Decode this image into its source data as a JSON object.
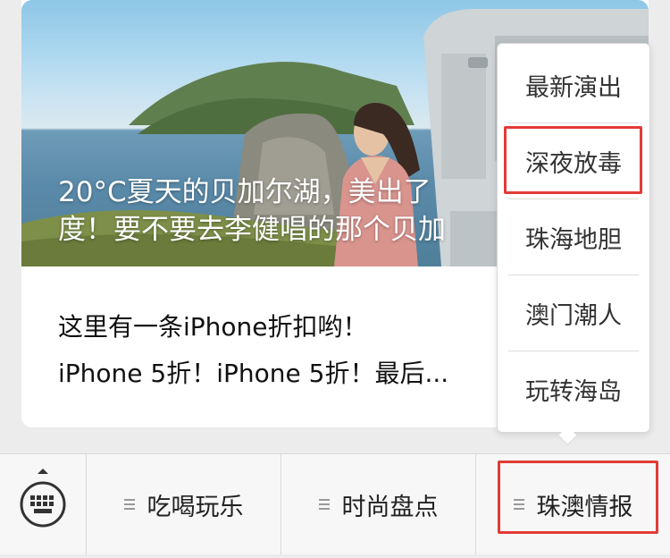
{
  "article": {
    "title_line1": "20°C夏天的贝加尔湖，美出了",
    "title_line2": "度！要不要去李健唱的那个贝加",
    "summary_line1": "这里有一条iPhone折扣哟！",
    "summary_line2": "iPhone 5折！iPhone 5折！最后..."
  },
  "popup_menu": {
    "items": [
      {
        "label": "最新演出",
        "highlighted": false
      },
      {
        "label": "深夜放毒",
        "highlighted": true
      },
      {
        "label": "珠海地胆",
        "highlighted": false
      },
      {
        "label": "澳门潮人",
        "highlighted": false
      },
      {
        "label": "玩转海岛",
        "highlighted": false
      }
    ]
  },
  "bottom_menu": {
    "keyboard_icon": "keyboard-icon",
    "items": [
      {
        "label": "吃喝玩乐"
      },
      {
        "label": "时尚盘点"
      },
      {
        "label": "珠澳情报",
        "highlighted": true
      }
    ]
  },
  "colors": {
    "highlight_box": "#e23b36",
    "menu_bar_bg": "#f7f7f7"
  }
}
